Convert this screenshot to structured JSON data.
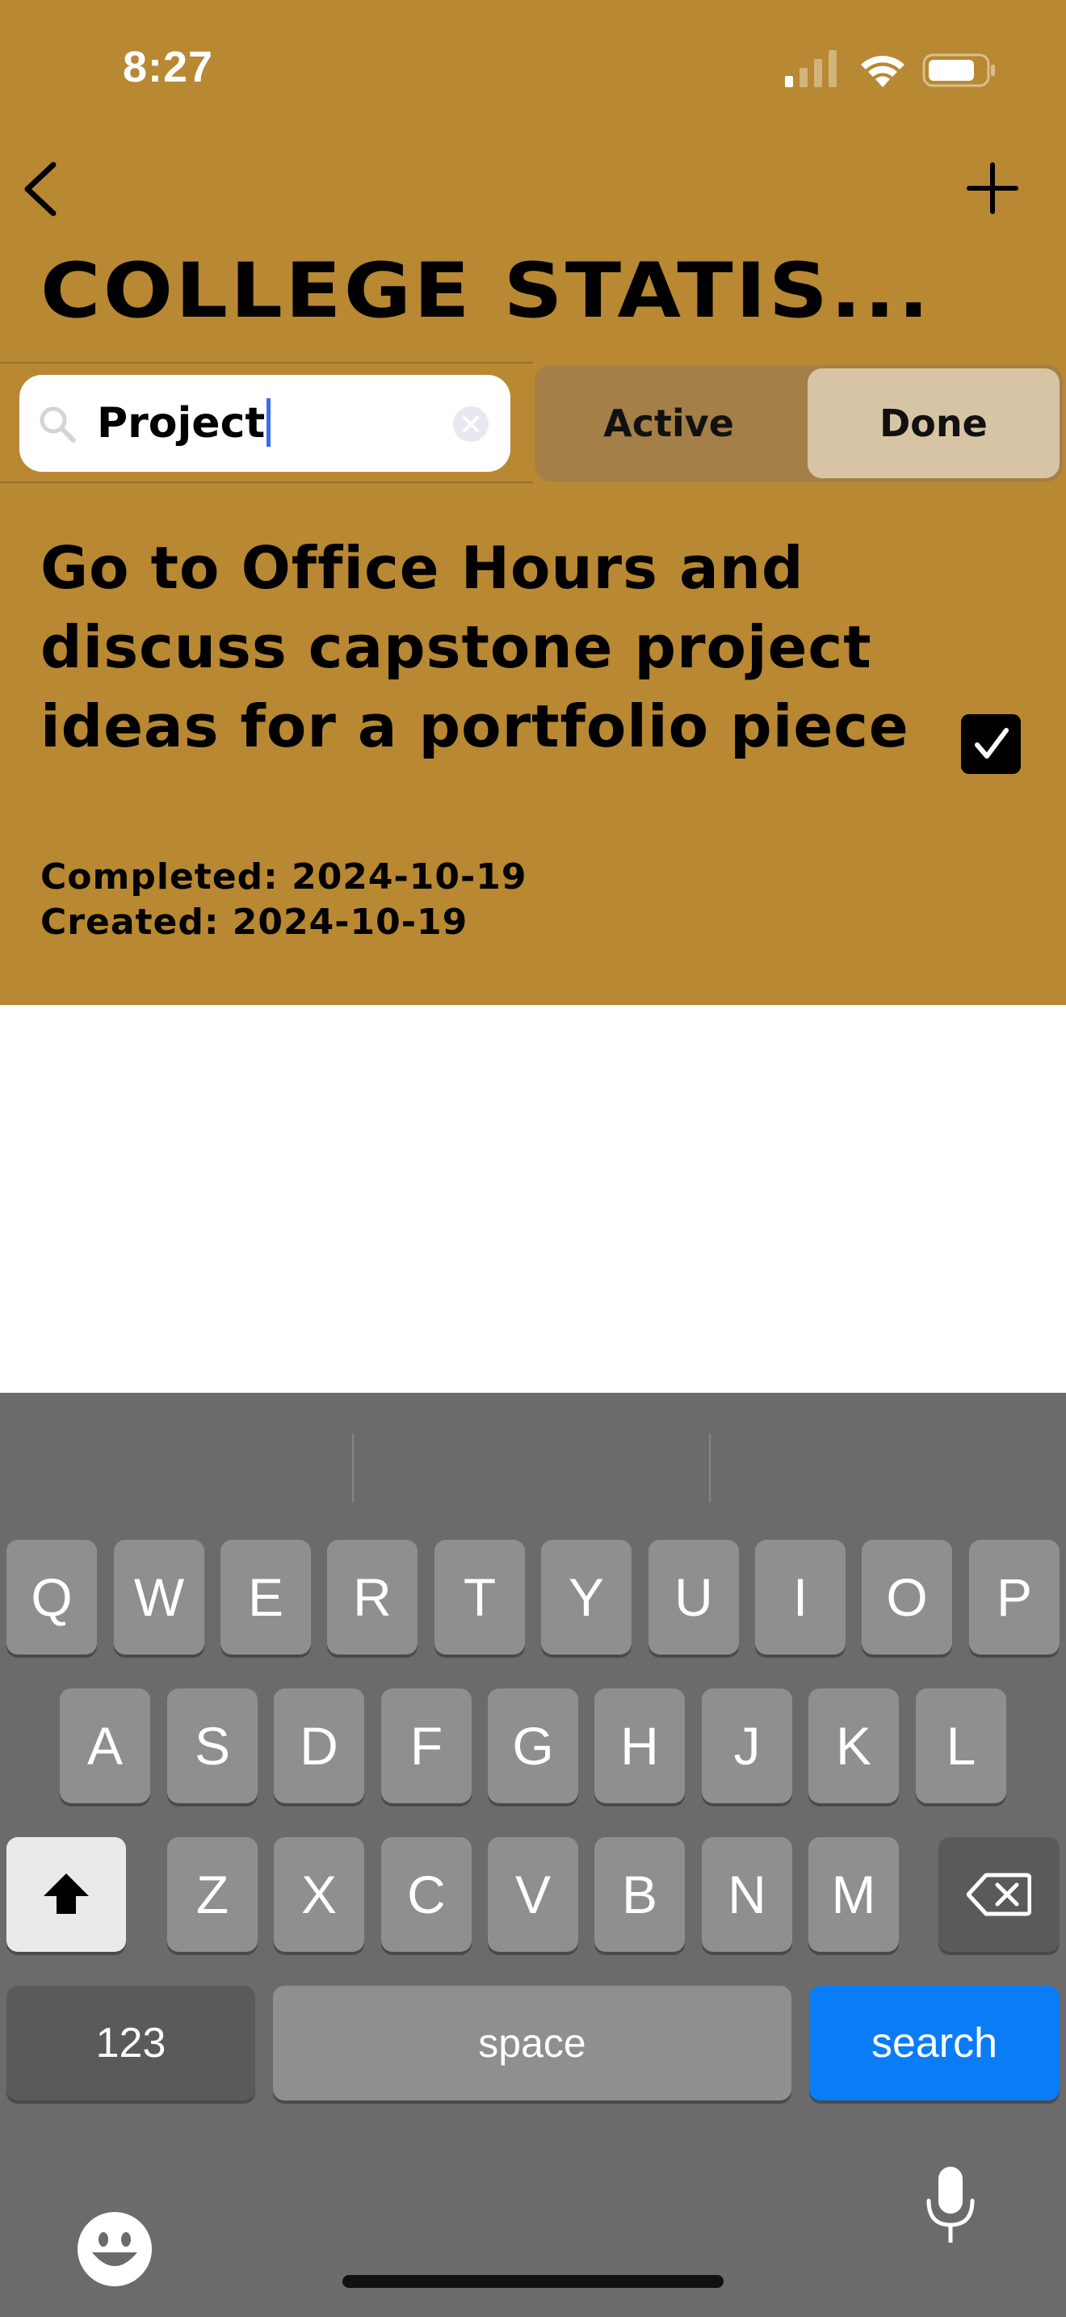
{
  "status_bar": {
    "time": "8:27"
  },
  "nav": {
    "back_icon": "chevron-left-icon",
    "add_icon": "plus-icon"
  },
  "page": {
    "title": "COLLEGE STATIS..."
  },
  "search": {
    "value": "Project",
    "search_icon": "magnifier-icon",
    "clear_icon": "clear-x-icon"
  },
  "filter": {
    "active_label": "Active",
    "done_label": "Done",
    "selected": "Done"
  },
  "task": {
    "title": "Go to Office Hours and discuss capstone project ideas for a portfolio piece",
    "completed": "Completed: 2024-10-19",
    "created": "Created: 2024-10-19",
    "checked": true
  },
  "keyboard": {
    "row1": [
      "Q",
      "W",
      "E",
      "R",
      "T",
      "Y",
      "U",
      "I",
      "O",
      "P"
    ],
    "row2": [
      "A",
      "S",
      "D",
      "F",
      "G",
      "H",
      "J",
      "K",
      "L"
    ],
    "row3": [
      "Z",
      "X",
      "C",
      "V",
      "B",
      "N",
      "M"
    ],
    "numbers_label": "123",
    "space_label": "space",
    "search_label": "search"
  },
  "colors": {
    "app_bg": "#b88832",
    "segment_bg": "#a47f47",
    "segment_selected": "#d6c4a4",
    "keyboard_bg": "#6b6b6b",
    "search_key": "#0a7cf5"
  }
}
